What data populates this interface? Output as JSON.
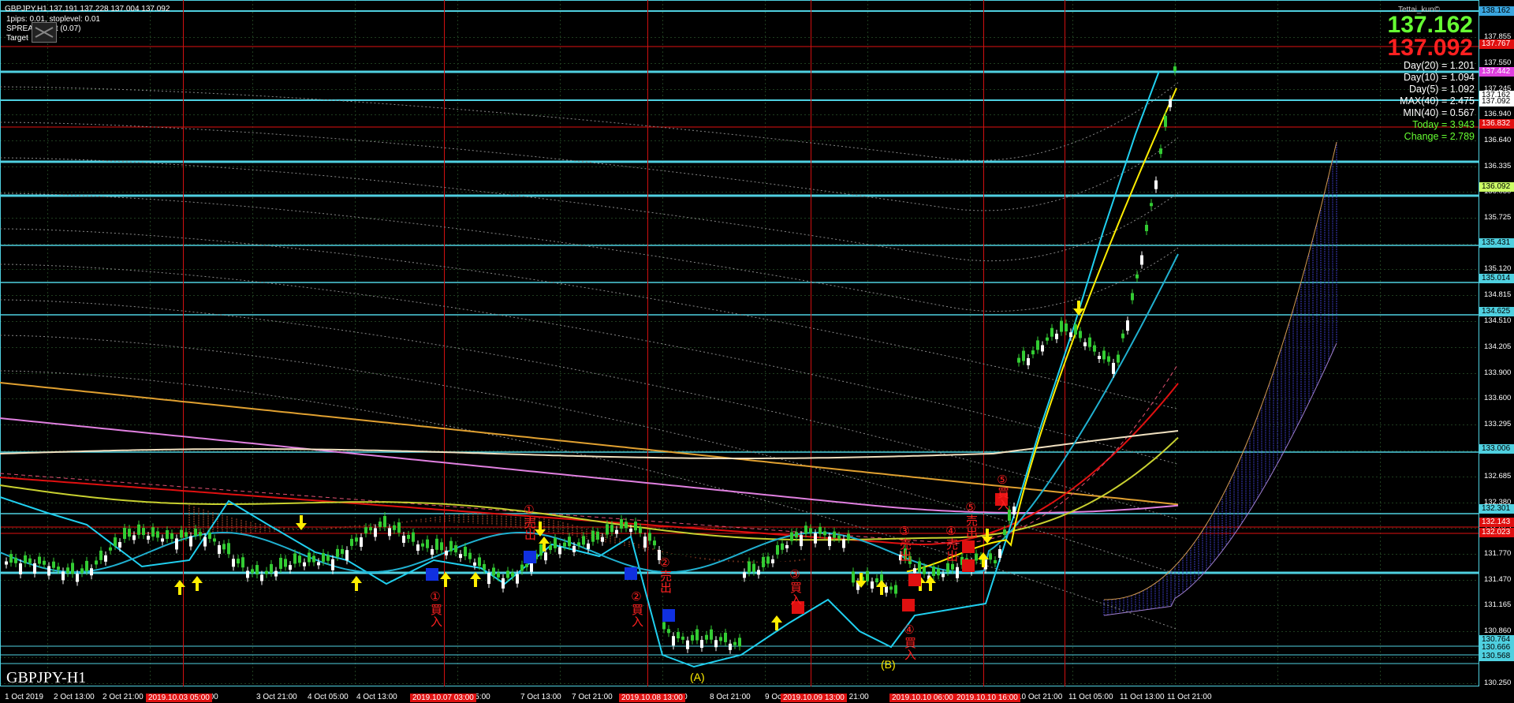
{
  "header": {
    "symbol_line": "GBPJPY,H1  137.191 137.228 137.004 137.092",
    "pips_line": "1pips: 0.01, stoplevel: 0.01",
    "spread_line": "SPREAD     point (0.07)",
    "target_line": "Target"
  },
  "credit": "Tettai_kun©",
  "symbol_watermark": "GBPJPY-H1",
  "price_panel": {
    "bid": "137.162",
    "ask": "137.092",
    "day20": "Day(20) = 1.201",
    "day10": "Day(10) = 1.094",
    "day5": "Day(5) = 1.092",
    "max40": "MAX(40) = 2.475",
    "min40": "MIN(40) = 0.567",
    "today": "Today = 3.943",
    "change": "Change = 2.789"
  },
  "price_scale": [
    "138.160",
    "137.855",
    "137.550",
    "137.245",
    "136.940",
    "136.640",
    "136.335",
    "136.030",
    "135.725",
    "135.420",
    "135.120",
    "134.815",
    "134.510",
    "134.205",
    "133.900",
    "133.600",
    "133.295",
    "132.990",
    "132.685",
    "132.380",
    "132.075",
    "131.770",
    "131.470",
    "131.165",
    "130.860",
    "130.555",
    "130.250"
  ],
  "price_tags": [
    {
      "text": "138.162",
      "bg": "#3aa6e0",
      "fg": "#000"
    },
    {
      "text": "137.767",
      "bg": "#e01010",
      "fg": "#fff"
    },
    {
      "text": "137.442",
      "bg": "#e040e0",
      "fg": "#fff"
    },
    {
      "text": "137.162",
      "bg": "#ffffff",
      "fg": "#000"
    },
    {
      "text": "137.092",
      "bg": "#ffffff",
      "fg": "#000"
    },
    {
      "text": "136.832",
      "bg": "#e01010",
      "fg": "#fff"
    },
    {
      "text": "136.092",
      "bg": "#ccff66",
      "fg": "#000"
    },
    {
      "text": "135.431",
      "bg": "#4fd0e0",
      "fg": "#000"
    },
    {
      "text": "135.014",
      "bg": "#4fd0e0",
      "fg": "#000"
    },
    {
      "text": "134.625",
      "bg": "#4fd0e0",
      "fg": "#000"
    },
    {
      "text": "133.006",
      "bg": "#4fd0e0",
      "fg": "#000"
    },
    {
      "text": "132.301",
      "bg": "#4fd0e0",
      "fg": "#000"
    },
    {
      "text": "132.143",
      "bg": "#e01010",
      "fg": "#fff"
    },
    {
      "text": "132.023",
      "bg": "#e01010",
      "fg": "#fff"
    },
    {
      "text": "130.764",
      "bg": "#4fd0e0",
      "fg": "#000"
    },
    {
      "text": "130.666",
      "bg": "#4fd0e0",
      "fg": "#000"
    },
    {
      "text": "130.568",
      "bg": "#4fd0e0",
      "fg": "#000"
    }
  ],
  "time_labels": [
    "1 Oct 2019",
    "2 Oct 13:00",
    "2 Oct 21:00",
    "3 Oct 13:00",
    "3 Oct 21:00",
    "4 Oct 05:00",
    "4 Oct 13:00",
    "7 Oct 05:00",
    "7 Oct 13:00",
    "7 Oct 21:00",
    "8 Oct 13:00",
    "8 Oct 21:00",
    "9 Oct",
    "9 Oct 21:00",
    "10 Oct 21:00",
    "11 Oct 05:00",
    "11 Oct 13:00",
    "11 Oct 21:00"
  ],
  "time_badges": [
    "2019.10.03 05:00",
    "2019.10.07 03:00",
    "2019.10.08 13:00",
    "2019.10.09 13:00",
    "2019.10.10 06:00",
    "2019.10.10 16:00"
  ],
  "annotations": [
    {
      "num": "①",
      "text": "買入"
    },
    {
      "num": "②",
      "text": "買入"
    },
    {
      "num": "③",
      "text": "買入"
    },
    {
      "num": "④",
      "text": "買入"
    },
    {
      "num": "⑤",
      "text": "買入"
    },
    {
      "num": "①",
      "text": "売出"
    },
    {
      "num": "②",
      "text": "売出"
    },
    {
      "num": "③",
      "text": "売出"
    },
    {
      "num": "④",
      "text": "売出"
    },
    {
      "num": "⑤",
      "text": "売出"
    }
  ],
  "wave_labels": [
    "(A)",
    "(B)"
  ],
  "colors": {
    "bull": "#33cc33",
    "bear": "#ffffff",
    "level": "#00e5ff",
    "vline": "#d01010",
    "grid": "#1f3d1f"
  }
}
